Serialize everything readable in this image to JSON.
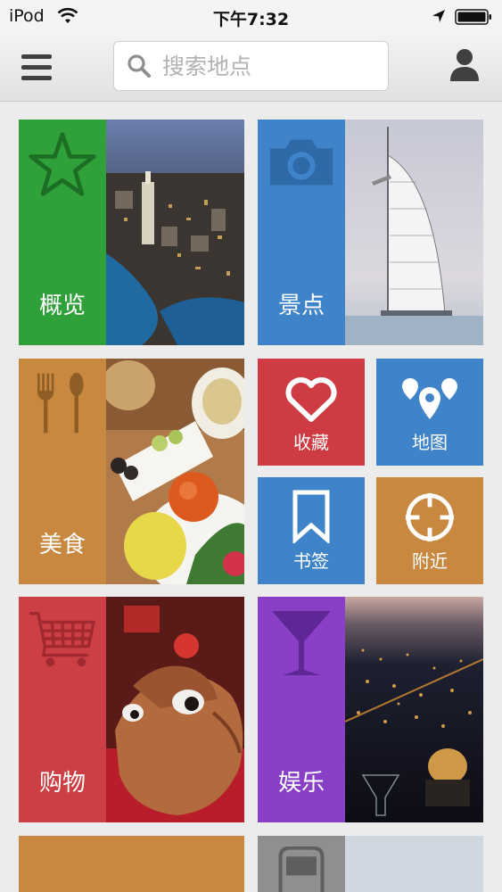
{
  "status_bar": {
    "carrier": "iPod",
    "time": "下午7:32"
  },
  "search": {
    "placeholder": "搜索地点"
  },
  "tiles": {
    "overview": {
      "label": "概览",
      "color": "#2fa03a",
      "icon": "star-icon"
    },
    "attractions": {
      "label": "景点",
      "color": "#3f83c9",
      "icon": "camera-icon"
    },
    "food": {
      "label": "美食",
      "color": "#c8883f",
      "icon": "fork-spoon-icon"
    },
    "favorites": {
      "label": "收藏",
      "color": "#cf3b43",
      "icon": "heart-icon"
    },
    "map": {
      "label": "地图",
      "color": "#3f83c9",
      "icon": "map-pins-icon"
    },
    "bookmarks": {
      "label": "书签",
      "color": "#3f83c9",
      "icon": "bookmark-icon"
    },
    "nearby": {
      "label": "附近",
      "color": "#c8883f",
      "icon": "crosshair-icon"
    },
    "shopping": {
      "label": "购物",
      "color": "#cc3f45",
      "icon": "cart-icon"
    },
    "entertainment": {
      "label": "娱乐",
      "color": "#8a3fc7",
      "icon": "cocktail-icon"
    },
    "bottom_left": {
      "label": "",
      "color": "#c8883f"
    },
    "transport": {
      "label": "",
      "color": "#8f8f8f",
      "icon": "bus-icon"
    }
  }
}
